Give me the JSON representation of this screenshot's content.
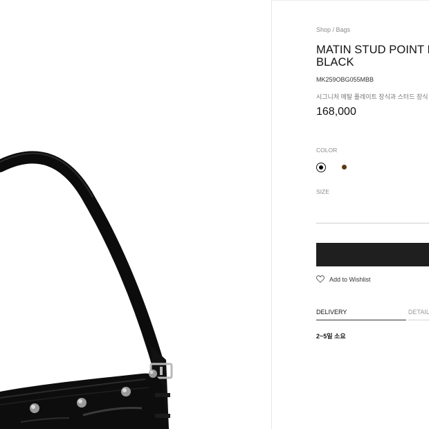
{
  "product": {
    "breadcrumb": "Shop / Bags",
    "title_line1": "MATIN STUD POINT L",
    "title_line2": "BLACK",
    "sku": "MK259OBG055MBB",
    "description": "시그니처 메탈 플레이트 장식과 스터드 장식",
    "price": "168,000"
  },
  "options": {
    "color_label": "COLOR",
    "colors": [
      {
        "name": "black",
        "hex": "#000000",
        "selected": true
      },
      {
        "name": "brown",
        "hex": "#5a3812",
        "selected": false
      }
    ],
    "size_label": "SIZE"
  },
  "actions": {
    "buy_button_color": "#1f1f1f",
    "wishlist_label": "Add to Wishlist",
    "wishlist_icon": "heart-outline-icon"
  },
  "tabs": {
    "items": [
      {
        "label": "DELIVERY",
        "active": true
      },
      {
        "label": "DETAIL",
        "active": false
      }
    ],
    "delivery_text": "2~5일 소요"
  }
}
